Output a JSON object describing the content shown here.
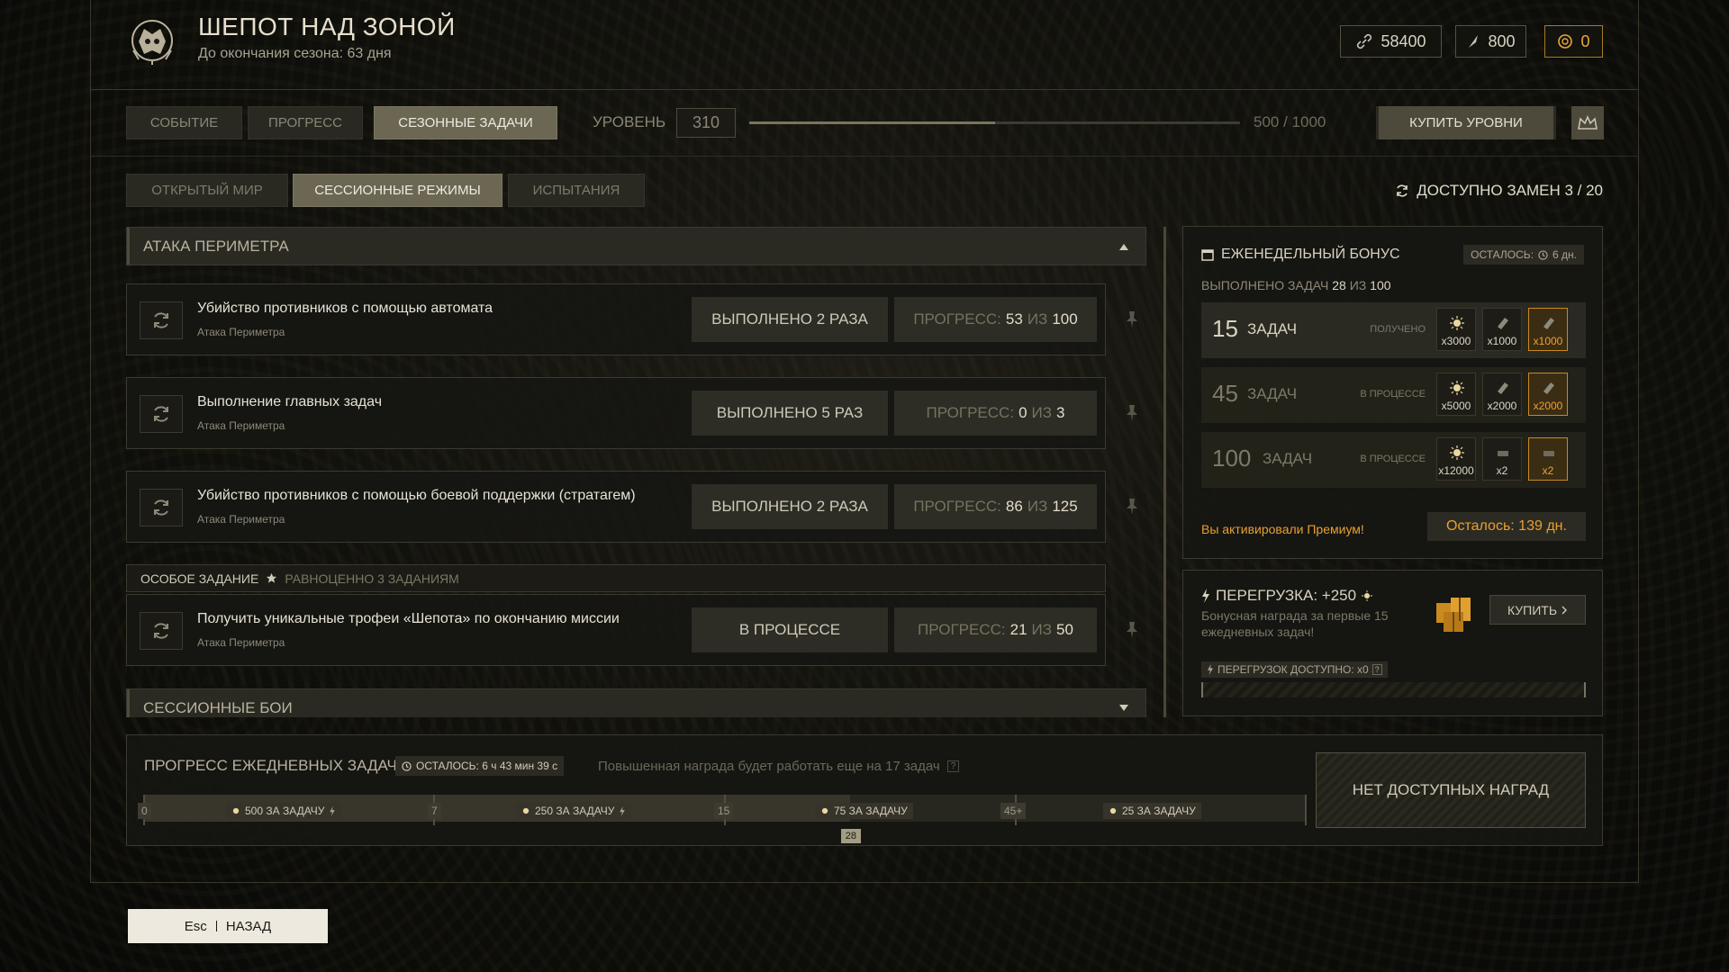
{
  "header": {
    "title": "ШЕПОТ НАД ЗОНОЙ",
    "subtitle": "До окончания сезона: 63 дня",
    "currencies": [
      {
        "icon": "link-icon",
        "value": "58400"
      },
      {
        "icon": "feather-icon",
        "value": "800"
      },
      {
        "icon": "coin-icon",
        "value": "0"
      }
    ]
  },
  "nav": {
    "tabs": [
      "СОБЫТИЕ",
      "ПРОГРЕСС",
      "СЕЗОННЫЕ ЗАДАЧИ"
    ],
    "active_tab": "СЕЗОННЫЕ ЗАДАЧИ",
    "level_label": "УРОВЕНЬ",
    "level_value": "310",
    "level_progress_fraction": 0.5,
    "level_progress_text": "500 / 1000",
    "buy_levels": "КУПИТЬ УРОВНИ"
  },
  "subnav": {
    "tabs": [
      "ОТКРЫТЫЙ МИР",
      "СЕССИОННЫЕ РЕЖИМЫ",
      "ИСПЫТАНИЯ"
    ],
    "active_tab": "СЕССИОННЫЕ РЕЖИМЫ",
    "replacements": "ДОСТУПНО ЗАМЕН 3 / 20"
  },
  "sections": {
    "first": "АТАКА ПЕРИМЕТРА",
    "second": "СЕССИОННЫЕ БОИ"
  },
  "tasks": [
    {
      "name": "Убийство противников с помощью автомата",
      "sub": "Атака Периметра",
      "done": "ВЫПОЛНЕНО 2 РАЗА",
      "prog_label": "ПРОГРЕСС:",
      "cur": "53",
      "of": "ИЗ",
      "total": "100"
    },
    {
      "name": "Выполнение главных задач",
      "sub": "Атака Периметра",
      "done": "ВЫПОЛНЕНО 5 РАЗ",
      "prog_label": "ПРОГРЕСС:",
      "cur": "0",
      "of": "ИЗ",
      "total": "3"
    },
    {
      "name": "Убийство противников с помощью боевой поддержки (стратагем)",
      "sub": "Атака Периметра",
      "done": "ВЫПОЛНЕНО 2 РАЗА",
      "prog_label": "ПРОГРЕСС:",
      "cur": "86",
      "of": "ИЗ",
      "total": "125"
    },
    {
      "name": "Получить уникальные трофеи «Шепота» по окончанию миссии",
      "sub": "Атака Периметра",
      "done": "В ПРОЦЕССЕ",
      "prog_label": "ПРОГРЕСС:",
      "cur": "21",
      "of": "ИЗ",
      "total": "50"
    }
  ],
  "special": {
    "label": "ОСОБОЕ ЗАДАНИЕ",
    "note": "РАВНОЦЕННО 3 ЗАДАНИЯМ"
  },
  "weekly": {
    "title": "ЕЖЕНЕДЕЛЬНЫЙ БОНУС",
    "left_label": "ОСТАЛОСЬ:",
    "left_value": "6 дн.",
    "done_label": "ВЫПОЛНЕНО ЗАДАЧ",
    "done_cur": "28",
    "done_of": "ИЗ",
    "done_total": "100",
    "tiers": [
      {
        "num": "15",
        "word": "ЗАДАЧ",
        "status": "ПОЛУЧЕНО",
        "rewards": [
          "x3000",
          "x1000",
          "x1000"
        ]
      },
      {
        "num": "45",
        "word": "ЗАДАЧ",
        "status": "В ПРОЦЕССЕ",
        "rewards": [
          "x5000",
          "x2000",
          "x2000"
        ]
      },
      {
        "num": "100",
        "word": "ЗАДАЧ",
        "status": "В ПРОЦЕССЕ",
        "rewards": [
          "x12000",
          "x2",
          "x2"
        ]
      }
    ],
    "premium_text": "Вы активировали Премиум!",
    "premium_left": "Осталось: 139 дн."
  },
  "overload": {
    "title": "ПЕРЕГРУЗКА: +250",
    "desc": "Бонусная награда за первые 15 ежедневных задач!",
    "buy": "КУПИТЬ",
    "available": "ПЕРЕГРУЗОК ДОСТУПНО: x0",
    "help": "?"
  },
  "daily": {
    "title": "ПРОГРЕСС ЕЖЕДНЕВНЫХ ЗАДАЧ",
    "left": "ОСТАЛОСЬ: 6 ч 43 мин 39 с",
    "note": "Повышенная награда будет работать еще на 17 задач",
    "help": "?",
    "thresholds": [
      "0",
      "7",
      "15",
      "45+"
    ],
    "segments": [
      "500 ЗА ЗАДАЧУ",
      "250 ЗА ЗАДАЧУ",
      "75 ЗА ЗАДАЧУ",
      "25 ЗА ЗАДАЧУ"
    ],
    "current": "28",
    "no_rewards": "НЕТ ДОСТУПНЫХ НАГРАД"
  },
  "footer": {
    "key": "Esc",
    "back": "НАЗАД"
  },
  "colors": {
    "accent_gold": "#e8a030",
    "active_tab": "#6c6753",
    "panel": "#161612"
  }
}
